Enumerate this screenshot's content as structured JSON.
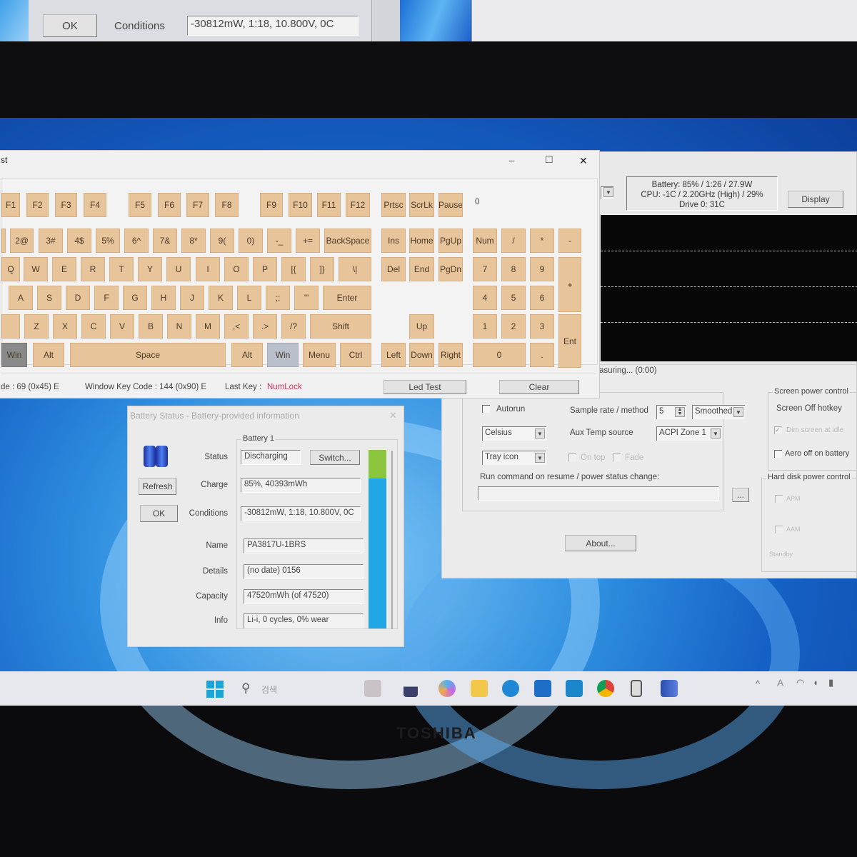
{
  "prev_window": {
    "ok_label": "OK",
    "conditions_label": "Conditions",
    "conditions_value": "-30812mW, 1:18, 10.800V, 0C"
  },
  "keyboard_window": {
    "title": "st",
    "controls": {
      "minimize": "–",
      "maximize": "☐",
      "close": "✕"
    },
    "indicator": "0",
    "rows": [
      [
        "F1",
        "F2",
        "F3",
        "F4",
        "F5",
        "F6",
        "F7",
        "F8",
        "F9",
        "F10",
        "F11",
        "F12",
        "Prtsc",
        "ScrLk",
        "Pause"
      ],
      [
        "",
        "2@",
        "3#",
        "4$",
        "5%",
        "6^",
        "7&",
        "8*",
        "9(",
        "0)",
        "-_",
        "+=",
        "BackSpace",
        "Ins",
        "Home",
        "PgUp",
        "Num",
        "/",
        "*",
        "-"
      ],
      [
        "Q",
        "W",
        "E",
        "R",
        "T",
        "Y",
        "U",
        "I",
        "O",
        "P",
        "[{",
        "]}",
        "\\|",
        "Del",
        "End",
        "PgDn",
        "7",
        "8",
        "9",
        "+"
      ],
      [
        "A",
        "S",
        "D",
        "F",
        "G",
        "H",
        "J",
        "K",
        "L",
        ";:",
        "'\"",
        "Enter",
        "4",
        "5",
        "6"
      ],
      [
        "",
        "Z",
        "X",
        "C",
        "V",
        "B",
        "N",
        "M",
        ",<",
        ".>",
        "/?",
        "Shift",
        "Up",
        "1",
        "2",
        "3",
        "Ent"
      ],
      [
        "Win",
        "Alt",
        "Space",
        "Alt",
        "Win",
        "Menu",
        "Ctrl",
        "Left",
        "Down",
        "Right",
        "0",
        "."
      ]
    ],
    "status": {
      "scan_code": "de : 69 (0x45) E",
      "window_key_code": "Window Key Code : 144 (0x90) E",
      "last_key_label": "Last Key :",
      "last_key_value": "NumLock",
      "led_test": "Led Test",
      "clear": "Clear"
    },
    "colors": {
      "key": "#e7c499",
      "pressed_dark": "#8a8a8a",
      "pressed_light": "#b9c0cc",
      "last_key": "#e0305a"
    }
  },
  "monitor_window": {
    "status_lines": [
      "Battery: 85% / 1:26 / 27.9W",
      "CPU: -1C / 2.20GHz (High) / 29%",
      "Drive 0: 31C"
    ],
    "display_button": "Display",
    "measuring": "asuring... (0:00)"
  },
  "settings": {
    "autorun": "Autorun",
    "sample_rate_label": "Sample rate / method",
    "sample_rate_value": "5",
    "method_value": "Smoothed",
    "units_value": "Celsius",
    "aux_temp_label": "Aux Temp source",
    "aux_temp_value": "ACPI Zone 1",
    "display_mode_value": "Tray icon",
    "on_top": "On top",
    "fade": "Fade",
    "run_command_label": "Run command on resume / power status change:",
    "browse_button": "...",
    "about_button": "About...",
    "screen_power": {
      "title": "Screen power control",
      "hotkey": "Screen Off hotkey",
      "dim": "Dim screen at idle",
      "aero": "Aero off on battery"
    },
    "hdd_power": {
      "title": "Hard disk power control",
      "apm": "APM",
      "aam": "AAM",
      "standby": "Standby"
    }
  },
  "battery_dialog": {
    "title": "Battery Status - Battery-provided information",
    "close": "✕",
    "refresh": "Refresh",
    "ok": "OK",
    "group": "Battery 1",
    "switch": "Switch...",
    "fields": [
      {
        "label": "Status",
        "value": "Discharging"
      },
      {
        "label": "Charge",
        "value": "85%, 40393mWh"
      },
      {
        "label": "Conditions",
        "value": "-30812mW, 1:18, 10.800V, 0C"
      },
      {
        "label": "Name",
        "value": "PA3817U-1BRS"
      },
      {
        "label": "Details",
        "value": "(no date) 0156"
      },
      {
        "label": "Capacity",
        "value": "47520mWh (of 47520)"
      },
      {
        "label": "Info",
        "value": "Li-i, 0 cycles, 0% wear"
      }
    ],
    "charge_percent": 85,
    "colors": {
      "bar": "#21a6e6",
      "bar_top": "#8cc63f"
    }
  },
  "taskbar": {
    "search_placeholder": "검색",
    "icons": [
      "start-icon",
      "search-icon",
      "widgets-icon",
      "files-icon",
      "copilot-icon",
      "file-explorer-icon",
      "edge-icon",
      "store-icon",
      "outlook-icon",
      "chrome-icon",
      "notepad-icon",
      "battery-tool-icon"
    ]
  },
  "laptop": {
    "brand": "TOSHIBA"
  }
}
